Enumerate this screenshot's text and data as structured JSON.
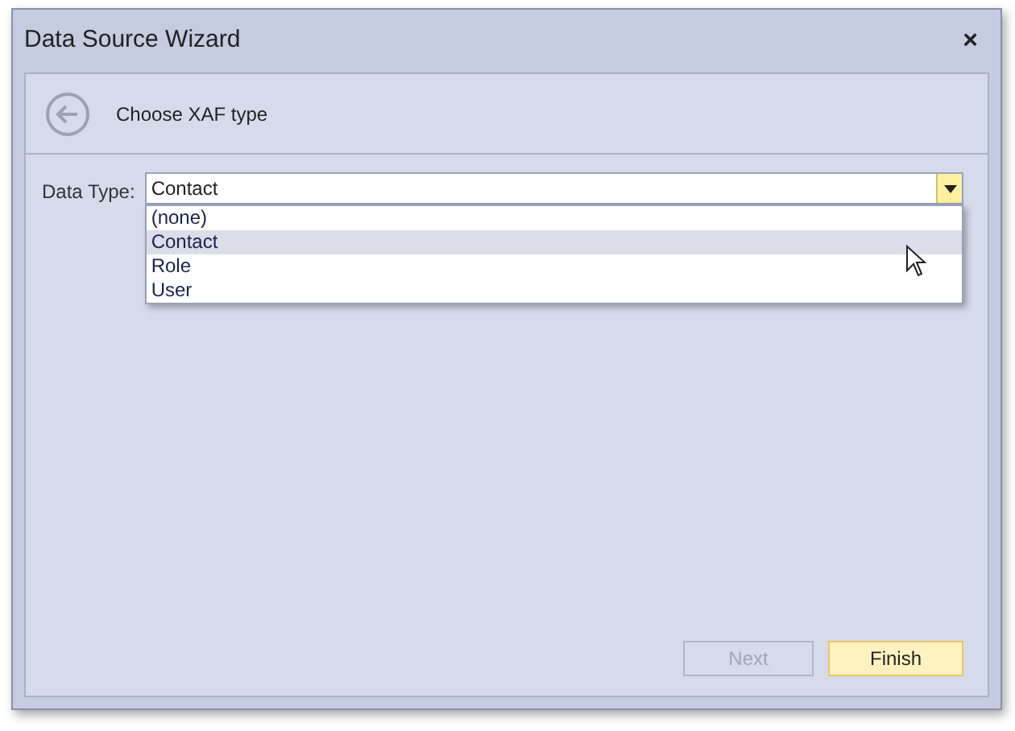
{
  "window": {
    "title": "Data Source Wizard",
    "close": "×"
  },
  "header": {
    "title": "Choose XAF type"
  },
  "field": {
    "label": "Data Type:",
    "value": "Contact",
    "expanded": true
  },
  "options": [
    {
      "label": "(none)",
      "selected": false
    },
    {
      "label": "Contact",
      "selected": true
    },
    {
      "label": "Role",
      "selected": false
    },
    {
      "label": "User",
      "selected": false
    }
  ],
  "buttons": [
    {
      "label": "Next",
      "disabled": true
    },
    {
      "label": "Finish",
      "disabled": false
    }
  ]
}
